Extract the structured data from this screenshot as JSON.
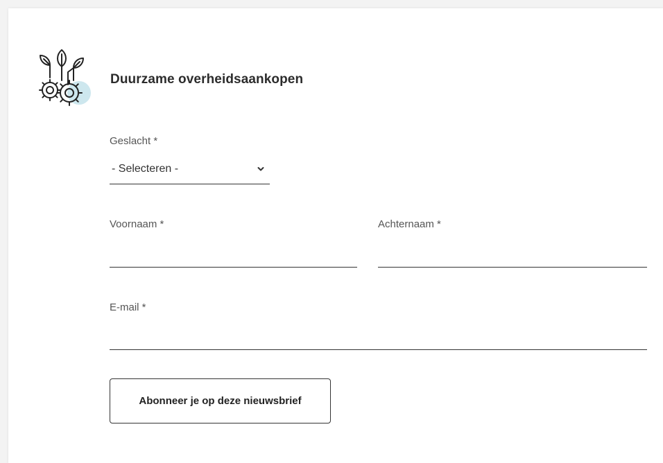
{
  "header": {
    "title": "Duurzame overheidsaankopen",
    "logo_icon": "plants-with-gears-icon",
    "accent_color": "#cde7ee"
  },
  "form": {
    "gender": {
      "label": "Geslacht *",
      "selected": "- Selecteren -"
    },
    "first_name": {
      "label": "Voornaam *",
      "value": ""
    },
    "last_name": {
      "label": "Achternaam *",
      "value": ""
    },
    "email": {
      "label": "E-mail *",
      "value": ""
    },
    "submit_label": "Abonneer je op deze nieuwsbrief"
  }
}
